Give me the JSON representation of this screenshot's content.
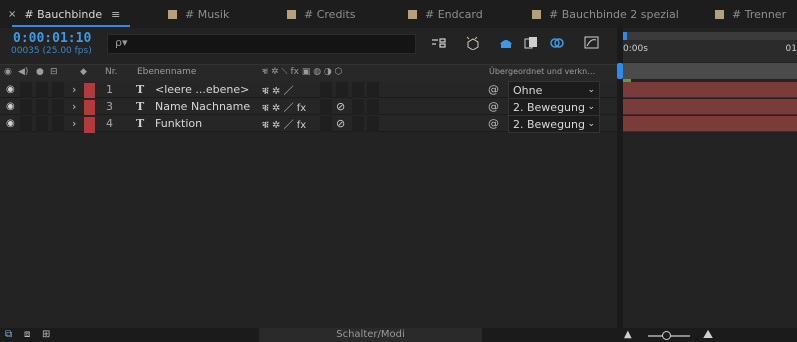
{
  "tabs": [
    {
      "label": "# Bauchbinde",
      "active": true
    },
    {
      "label": "# Musik"
    },
    {
      "label": "# Credits"
    },
    {
      "label": "# Endcard"
    },
    {
      "label": "# Bauchbinde 2 spezial"
    },
    {
      "label": "# Trenner"
    }
  ],
  "tab_close": "×",
  "tab_menu": "≡",
  "timecode": "0:00:01:10",
  "fps_info": "00035 (25.00 fps)",
  "search": {
    "icon": "ρ▾"
  },
  "header": {
    "nr": "Nr.",
    "ebenenname": "Ebenenname",
    "parent": "Übergeordnet und verkn…",
    "switch_icons": "ቑ ✲ ⟍ fx ▣ ◍ ◑ ⬡"
  },
  "layers": [
    {
      "nr": "1",
      "type": "T",
      "name": "<leere ...ebene>",
      "switches": "ቑ ✲ ／",
      "parent": "Ohne"
    },
    {
      "nr": "3",
      "type": "T",
      "name": "Name Nachname",
      "switches": "ቑ ✲ ／ fx",
      "parent": "2. Bewegung"
    },
    {
      "nr": "4",
      "type": "T",
      "name": "Funktion",
      "switches": "ቑ ✲ ／ fx",
      "parent": "2. Bewegung"
    }
  ],
  "ruler": {
    "start": "0:00s",
    "end": "01"
  },
  "bottom": {
    "switch_label": "Schalter/Modi"
  },
  "colors": {
    "accent": "#2d8ceb",
    "label_red": "#b33a3a",
    "layer_bar": "#7a3b3b",
    "tab_swatch": "#b4a07c"
  }
}
